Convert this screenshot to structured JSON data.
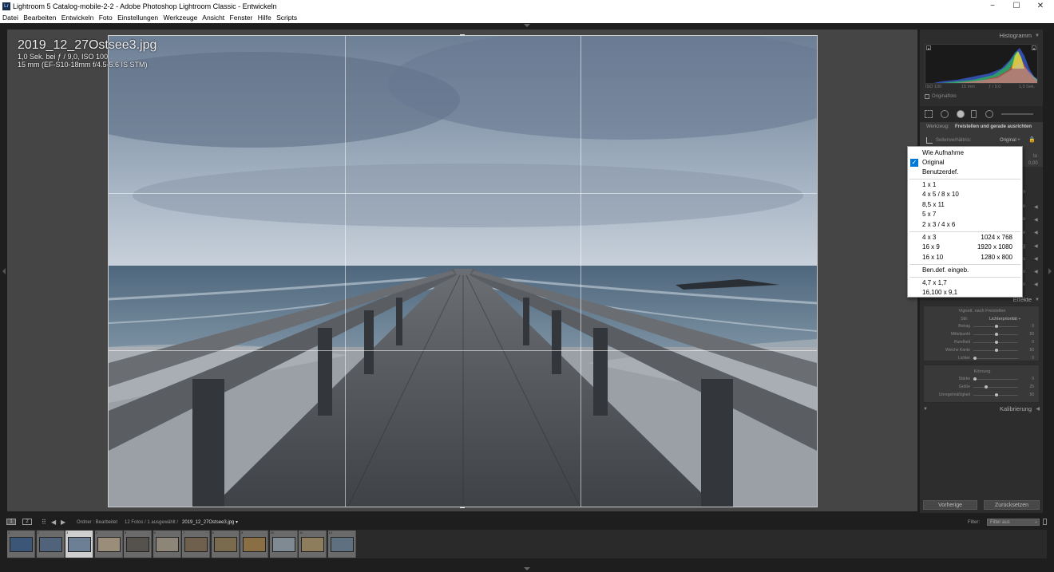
{
  "window": {
    "title": "Lightroom 5 Catalog-mobile-2-2 - Adobe Photoshop Lightroom Classic - Entwickeln",
    "app_icon": "Lr",
    "minimize": "−",
    "maximize": "☐",
    "close": "✕"
  },
  "menu": [
    "Datei",
    "Bearbeiten",
    "Entwickeln",
    "Foto",
    "Einstellungen",
    "Werkzeuge",
    "Ansicht",
    "Fenster",
    "Hilfe",
    "Scripts"
  ],
  "info_overlay": {
    "filename": "2019_12_27Ostsee3.jpg",
    "exposure": "1,0 Sek. bei ƒ / 9,0, ISO 100",
    "lens": "15 mm (EF-S10-18mm f/4.5-5.6 IS STM)"
  },
  "right_panel": {
    "histogram_label": "Histogramm",
    "hist_info": {
      "iso": "ISO 100",
      "focal": "15 mm",
      "aperture": "ƒ / 9,0",
      "shutter": "1,0 Sek."
    },
    "original_photo": "Originalfoto",
    "werkzeug_label": "Werkzeug:",
    "werkzeug_value": "Freistellen und gerade ausrichten",
    "aspect_label": "Seitenverhältnis:",
    "aspect_value": "Original ÷",
    "aspect_lock": "🔒",
    "peek_to": "to",
    "peek_value": "0,00",
    "partial_labels": [
      "tlen",
      "em",
      "rve",
      "Ite",
      "ung",
      "ails",
      "em",
      "em"
    ],
    "effects_label": "Effekte",
    "vignette_title": "Vignett. nach Freistellen",
    "stil_label": "Stil:",
    "stil_value": "Lichterpriorität ÷",
    "vignette_sliders": [
      {
        "label": "Betrag",
        "value": "0",
        "pos": 0.5
      },
      {
        "label": "Mittelpunkt",
        "value": "50",
        "pos": 0.5
      },
      {
        "label": "Rundheit",
        "value": "0",
        "pos": 0.5
      },
      {
        "label": "Weiche Kante",
        "value": "50",
        "pos": 0.5
      },
      {
        "label": "Lichter",
        "value": "0",
        "pos": 0.0
      }
    ],
    "grain_title": "Körnung",
    "grain_sliders": [
      {
        "label": "Stärke",
        "value": "0",
        "pos": 0.0
      },
      {
        "label": "Größe",
        "value": "25",
        "pos": 0.25
      },
      {
        "label": "Unregelmäßigkeit",
        "value": "50",
        "pos": 0.5
      }
    ],
    "calibration_label": "Kalibrierung",
    "prev_button": "Vorherige",
    "reset_button": "Zurücksetzen"
  },
  "dropdown": {
    "items": [
      {
        "label": "Wie Aufnahme",
        "res": "",
        "checked": false
      },
      {
        "label": "Original",
        "res": "",
        "checked": true
      },
      {
        "label": "Benutzerdef.",
        "res": "",
        "checked": false
      },
      {
        "label": "1 x 1",
        "res": "",
        "checked": false
      },
      {
        "label": "4 x 5 / 8 x 10",
        "res": "",
        "checked": false
      },
      {
        "label": "8,5 x 11",
        "res": "",
        "checked": false
      },
      {
        "label": "5 x 7",
        "res": "",
        "checked": false
      },
      {
        "label": "2 x 3 / 4 x 6",
        "res": "",
        "checked": false
      },
      {
        "label": "4 x 3",
        "res": "1024 x 768",
        "checked": false
      },
      {
        "label": "16 x 9",
        "res": "1920 x 1080",
        "checked": false
      },
      {
        "label": "16 x 10",
        "res": "1280 x 800",
        "checked": false
      },
      {
        "label": "Ben.def. eingeb.",
        "res": "",
        "checked": false
      },
      {
        "label": "4,7 x 1,7",
        "res": "",
        "checked": false
      },
      {
        "label": "16,100 x 9,1",
        "res": "",
        "checked": false
      }
    ],
    "check_mark": "✓"
  },
  "filmstrip_bar": {
    "tab1": "1",
    "tab2": "2",
    "path_label": "Ordner : Bearbeitet",
    "count_label": "12 Fotos / 1 ausgewählt /",
    "current_file": "2019_12_27Ostsee3.jpg ▾",
    "filter_label": "Filter:",
    "filter_value": "Filter aus"
  },
  "thumbnails": [
    {
      "num": "1",
      "color": "#3c5678"
    },
    {
      "num": "2",
      "color": "#51637a"
    },
    {
      "num": "3",
      "color": "#6c7f95",
      "selected": true
    },
    {
      "num": "4",
      "color": "#9a8e7a"
    },
    {
      "num": "5",
      "color": "#55524d"
    },
    {
      "num": "6",
      "color": "#8d8577"
    },
    {
      "num": "7",
      "color": "#6e604c"
    },
    {
      "num": "8",
      "color": "#7a6a4e"
    },
    {
      "num": "9",
      "color": "#8a6f45"
    },
    {
      "num": "10",
      "color": "#7f8a92"
    },
    {
      "num": "11",
      "color": "#8e7d5d"
    },
    {
      "num": "12",
      "color": "#5f7181"
    }
  ]
}
